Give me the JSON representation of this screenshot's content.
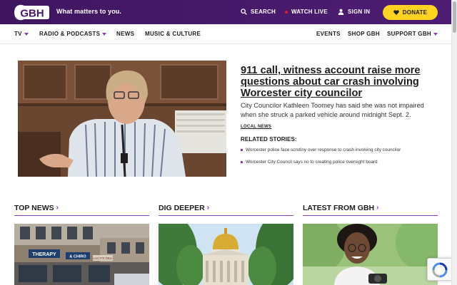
{
  "header": {
    "logo_text": "GBH",
    "tagline": "What matters to you.",
    "search_label": "SEARCH",
    "watch_live_label": "WATCH LIVE",
    "sign_in_label": "SIGN IN",
    "donate_label": "DONATE",
    "brand_color": "#4a1a6e",
    "donate_color": "#ffd21f",
    "live_color": "#e21b2c"
  },
  "nav": {
    "items": [
      {
        "label": "TV",
        "dropdown": true
      },
      {
        "label": "RADIO & PODCASTS",
        "dropdown": true
      },
      {
        "label": "NEWS",
        "dropdown": false
      },
      {
        "label": "MUSIC & CULTURE",
        "dropdown": false
      },
      {
        "label": "EVENTS",
        "dropdown": false
      },
      {
        "label": "SHOP GBH",
        "dropdown": false
      },
      {
        "label": "SUPPORT GBH",
        "dropdown": true
      }
    ],
    "accent_color": "#8a3fb3"
  },
  "hero": {
    "title": "911 call, witness account raise more questions about car crash involving Worcester city councilor",
    "description": "City Councilor Kathleen Toomey has said she was not impaired when she struck a parked vehicle around midnight Sept. 2.",
    "tag": "LOCAL NEWS",
    "related_heading": "RELATED STORIES:",
    "related": [
      "Worcester police face scrutiny over response to crash involving city councilor",
      "Worcester City Council says no to creating police oversight board"
    ]
  },
  "sections": [
    {
      "heading": "TOP NEWS",
      "image_signs": [
        "THERAPY",
        "& CHIRO",
        "LUCY'S DELI"
      ]
    },
    {
      "heading": "DIG DEEPER"
    },
    {
      "heading": "LATEST FROM GBH"
    }
  ],
  "icons": {
    "search": "search-icon",
    "user": "user-icon",
    "heart": "heart-icon",
    "recaptcha": "recaptcha-icon"
  }
}
